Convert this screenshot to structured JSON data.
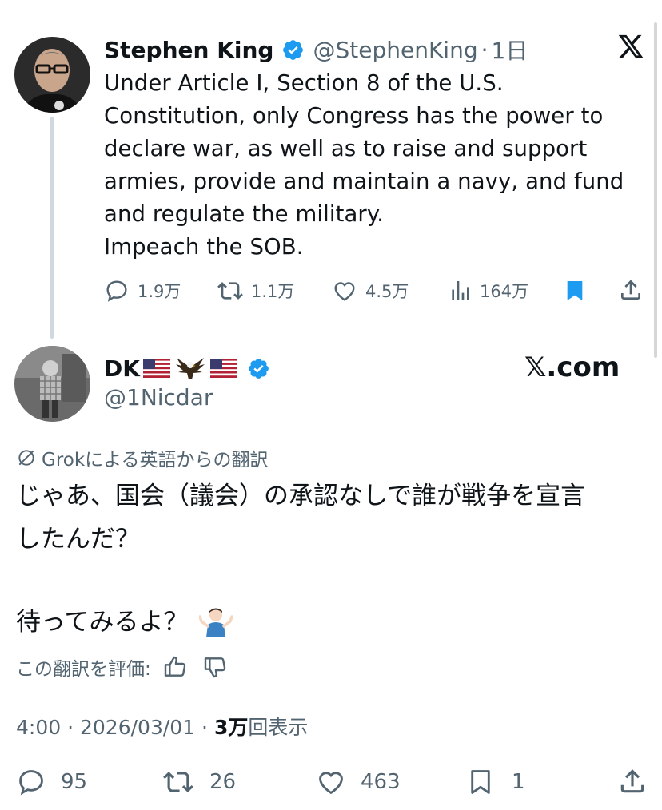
{
  "quoted": {
    "name": "Stephen King",
    "handle": "@StephenKing",
    "time": "1日",
    "lines": [
      "Under Article I, Section 8 of the U.S.",
      "Constitution, only Congress has the  power to",
      "declare war, as well as to raise and support",
      "armies, provide  and maintain a navy, and fund",
      "and regulate the military.",
      "Impeach the SOB."
    ],
    "stats": {
      "replies": "1.9万",
      "reposts": "1.1万",
      "likes": "4.5万",
      "views": "164万"
    }
  },
  "reply": {
    "name": "DK",
    "handle": "@1Nicdar",
    "watermark": "𝕏.com",
    "translation_label": "Grokによる英語からの翻訳",
    "text_line1": "じゃあ、国会（議会）の承認なしで誰が戦争を宣言",
    "text_line2": "したんだ？",
    "text_line3": "待ってみるよ？",
    "emoji": "🤷🏻‍♂️",
    "rate_label": "この翻訳を評価:",
    "time": "4:00",
    "date": "2026/03/01",
    "views_count": "3万",
    "views_label": "回表示",
    "stats": {
      "replies": "95",
      "reposts": "26",
      "likes": "463",
      "bookmarks": "1"
    }
  },
  "colors": {
    "verified": "#1d9bf0",
    "bookmark_active": "#1d9bf0",
    "text": "#0f1419",
    "muted": "#536471"
  }
}
